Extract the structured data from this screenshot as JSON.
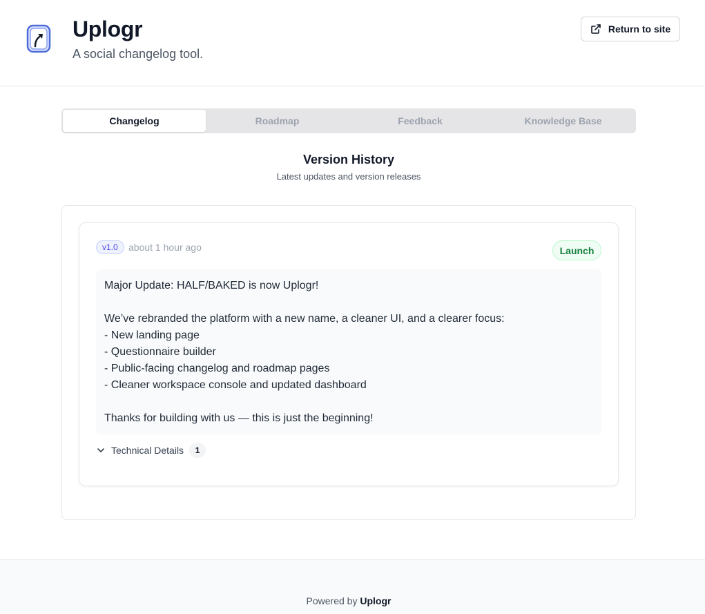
{
  "header": {
    "brand_name": "Uplogr",
    "tagline": "A social changelog tool.",
    "return_label": "Return to site",
    "logo_icon": "uplogr-logo",
    "return_icon": "external-link-icon"
  },
  "tabs": [
    {
      "label": "Changelog",
      "active": true
    },
    {
      "label": "Roadmap",
      "active": false
    },
    {
      "label": "Feedback",
      "active": false
    },
    {
      "label": "Knowledge Base",
      "active": false
    }
  ],
  "section": {
    "title": "Version History",
    "subtitle": "Latest updates and version releases"
  },
  "entry": {
    "version": "v1.0",
    "time_ago": "about 1 hour ago",
    "type": "Launch",
    "lines": [
      "Major Update: HALF/BAKED is now Uplogr!",
      "",
      "We’ve rebranded the platform with a new name, a cleaner UI, and a clearer focus:",
      "- New landing page",
      "- Questionnaire builder",
      "- Public-facing changelog and roadmap pages",
      "- Cleaner workspace console and updated dashboard",
      "",
      "Thanks for building with us — this is just the beginning!"
    ],
    "tech_details_label": "Technical Details",
    "tech_details_count": "1"
  },
  "footer": {
    "powered_by": "Powered by",
    "brand": "Uplogr"
  },
  "colors": {
    "accent_indigo": "#4f46e5",
    "launch_green": "#15803d",
    "logo_blue": "#4f6bd8"
  }
}
